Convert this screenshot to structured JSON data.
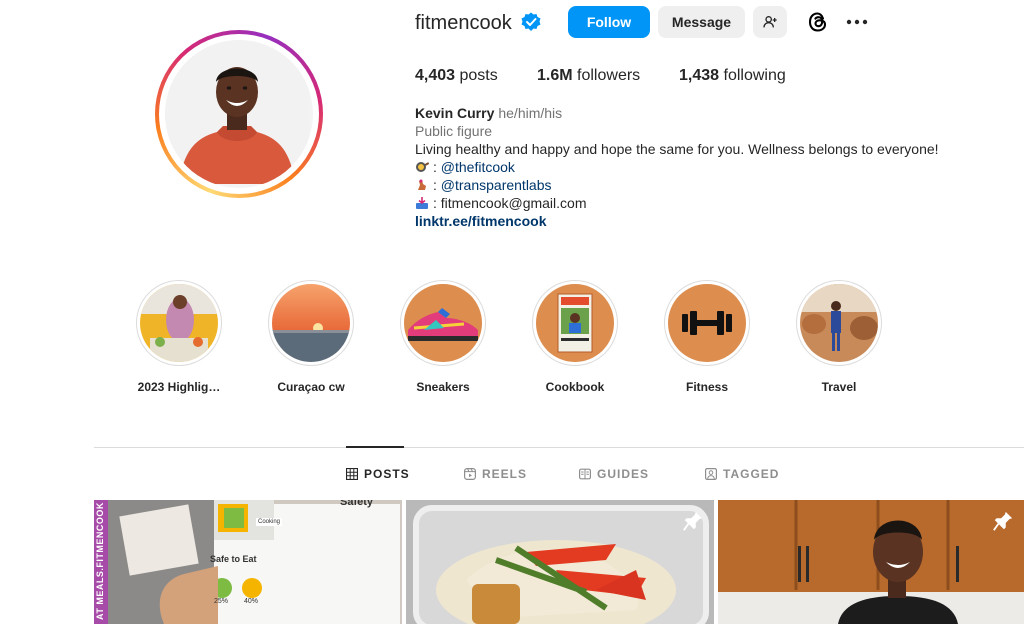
{
  "profile": {
    "username": "fitmencook",
    "verified": true,
    "follow_label": "Follow",
    "message_label": "Message"
  },
  "stats": {
    "posts_count": "4,403",
    "posts_label": "posts",
    "followers_count": "1.6M",
    "followers_label": "followers",
    "following_count": "1,438",
    "following_label": "following"
  },
  "bio": {
    "name": "Kevin Curry",
    "pronouns": "he/him/his",
    "category": "Public figure",
    "text": "Living healthy and happy and hope the same for you. Wellness belongs to everyone!",
    "links": [
      {
        "prefix": ": ",
        "text": "@thefitcook"
      },
      {
        "prefix": ": ",
        "text": "@transparentlabs"
      },
      {
        "prefix": ": ",
        "text": "fitmencook@gmail.com"
      }
    ],
    "website": "linktr.ee/fitmencook"
  },
  "highlights": [
    {
      "label": "2023 Highlig…"
    },
    {
      "label": "Curaçao cw"
    },
    {
      "label": "Sneakers"
    },
    {
      "label": "Cookbook"
    },
    {
      "label": "Fitness"
    },
    {
      "label": "Travel"
    }
  ],
  "tabs": {
    "posts": "POSTS",
    "reels": "REELS",
    "guides": "GUIDES",
    "tagged": "TAGGED"
  },
  "posts": [
    {
      "side_text": "AT MEALS.FITMENCOOK",
      "title": "Safety",
      "section": "Safe to Eat",
      "p1": "25%",
      "p2": "40%",
      "small_label": "Cooking"
    },
    {
      "pinned": true
    },
    {
      "pinned": true
    }
  ],
  "colors": {
    "follow_blue": "#0095f6",
    "verified_blue": "#0095f6",
    "link": "#00376b",
    "secondary_text": "#737373",
    "highlight_orange": "#dd8d4d"
  }
}
